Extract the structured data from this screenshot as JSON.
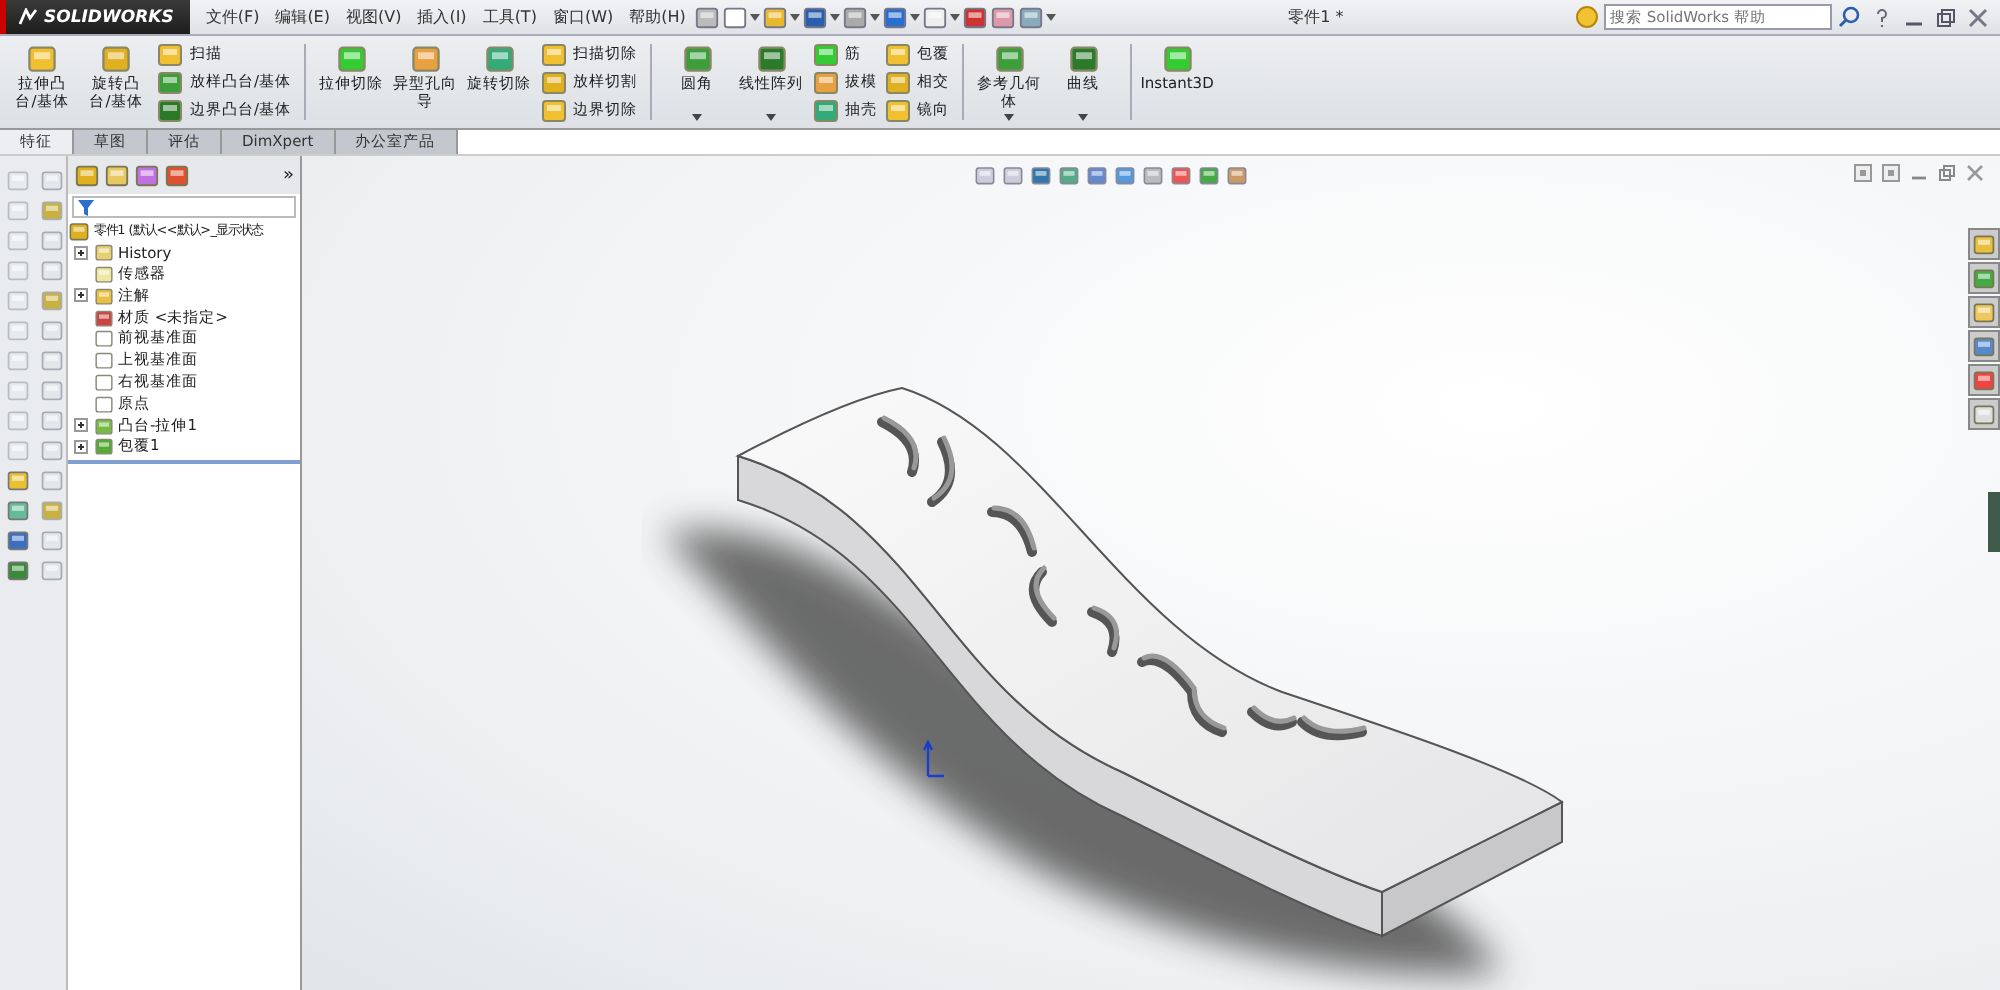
{
  "title_bar": {
    "logo": "SOLIDWORKS",
    "menu": [
      "文件(F)",
      "编辑(E)",
      "视图(V)",
      "插入(I)",
      "工具(T)",
      "窗口(W)",
      "帮助(H)"
    ],
    "document_title": "零件1 *",
    "search": {
      "placeholder": "搜索 SolidWorks 帮助"
    }
  },
  "ribbon": [
    [
      {
        "kind": "large",
        "label": "拉伸凸台/基体",
        "dropdown": false
      },
      {
        "kind": "large",
        "label": "旋转凸台/基体",
        "dropdown": false
      },
      {
        "kind": "stack",
        "items": [
          "扫描",
          "放样凸台/基体",
          "边界凸台/基体"
        ]
      }
    ],
    [
      {
        "kind": "large",
        "label": "拉伸切除",
        "dropdown": false
      },
      {
        "kind": "large",
        "label": "异型孔向导",
        "dropdown": false
      },
      {
        "kind": "large",
        "label": "旋转切除",
        "dropdown": false
      },
      {
        "kind": "stack",
        "items": [
          "扫描切除",
          "放样切割",
          "边界切除"
        ]
      }
    ],
    [
      {
        "kind": "large",
        "label": "圆角",
        "dropdown": true
      },
      {
        "kind": "large",
        "label": "线性阵列",
        "dropdown": true
      },
      {
        "kind": "stack",
        "items": [
          "筋",
          "拔模",
          "抽壳"
        ]
      },
      {
        "kind": "stack",
        "items": [
          "包覆",
          "相交",
          "镜向"
        ]
      }
    ],
    [
      {
        "kind": "large",
        "label": "参考几何体",
        "dropdown": true
      },
      {
        "kind": "large",
        "label": "曲线",
        "dropdown": true
      }
    ],
    [
      {
        "kind": "large",
        "label": "Instant3D",
        "dropdown": false
      }
    ]
  ],
  "tabs": [
    {
      "label": "特征",
      "selected": true
    },
    {
      "label": "草图",
      "selected": false
    },
    {
      "label": "评估",
      "selected": false
    },
    {
      "label": "DimXpert",
      "selected": false
    },
    {
      "label": "办公室产品",
      "selected": false
    }
  ],
  "feature_tree": {
    "expand_arrows": "»",
    "root": "零件1 (默认<<默认>_显示状态",
    "items": [
      {
        "label": "History",
        "collapsed": true
      },
      {
        "label": "传感器",
        "collapsed": false
      },
      {
        "label": "注解",
        "collapsed": true
      },
      {
        "label": "材质 <未指定>",
        "collapsed": false
      },
      {
        "label": "前视基准面",
        "collapsed": false
      },
      {
        "label": "上视基准面",
        "collapsed": false
      },
      {
        "label": "右视基准面",
        "collapsed": false
      },
      {
        "label": "原点",
        "collapsed": false
      },
      {
        "label": "凸台-拉伸1",
        "collapsed": true
      },
      {
        "label": "包覆1",
        "collapsed": true
      }
    ]
  }
}
